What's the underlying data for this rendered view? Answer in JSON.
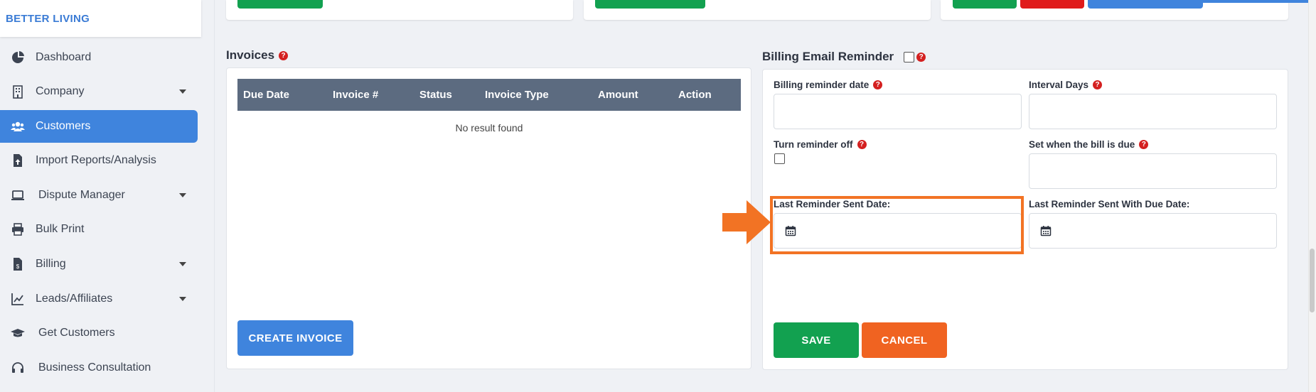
{
  "brand": "BETTER LIVING",
  "sidebar": {
    "items": [
      {
        "label": "Dashboard",
        "icon": "pie-chart-icon"
      },
      {
        "label": "Company",
        "icon": "building-icon"
      },
      {
        "label": "Customers",
        "icon": "users-icon"
      },
      {
        "label": "Import Reports/Analysis",
        "icon": "file-upload-icon"
      },
      {
        "label": "Dispute Manager",
        "icon": "laptop-icon"
      },
      {
        "label": "Bulk Print",
        "icon": "printer-icon"
      },
      {
        "label": "Billing",
        "icon": "invoice-dollar-icon"
      },
      {
        "label": "Leads/Affiliates",
        "icon": "line-chart-icon"
      },
      {
        "label": "Get Customers",
        "icon": "graduation-cap-icon"
      },
      {
        "label": "Business Consultation",
        "icon": "headset-icon"
      }
    ],
    "active": "Customers"
  },
  "invoices": {
    "title": "Invoices",
    "columns": [
      "Due Date",
      "Invoice #",
      "Status",
      "Invoice Type",
      "Amount",
      "Action"
    ],
    "empty_text": "No result found",
    "create_button": "CREATE INVOICE"
  },
  "reminder": {
    "title": "Billing Email Reminder",
    "billing_reminder_date_label": "Billing reminder date",
    "interval_days_label": "Interval Days",
    "turn_off_label": "Turn reminder off",
    "set_when_due_label": "Set when the bill is due",
    "last_sent_date_label": "Last Reminder Sent Date:",
    "last_sent_due_label": "Last Reminder Sent With Due Date:",
    "save_button": "SAVE",
    "cancel_button": "CANCEL"
  },
  "colors": {
    "primary": "#3f84dd",
    "success": "#12a150",
    "danger": "#e01b1b",
    "cancel": "#f06321",
    "highlight": "#f27324",
    "table_header": "#5c6b80"
  }
}
